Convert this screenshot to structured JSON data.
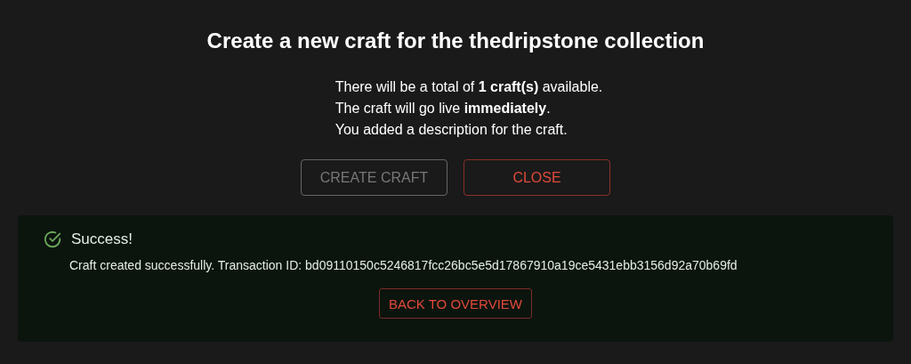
{
  "dialog": {
    "title": "Create a new craft for the thedripstone collection",
    "summary": [
      "There will be a total of **1 craft(s)** available.",
      "The craft will go live **immediately**.",
      "You added a description for the craft."
    ],
    "buttons": [
      {
        "label": "CREATE CRAFT",
        "kind": "primary",
        "disabled": true
      },
      {
        "label": "CLOSE",
        "kind": "danger",
        "disabled": false
      }
    ]
  },
  "alert": {
    "title": "Success!",
    "message": "Craft created successfully. Transaction ID: bd09110150c5246817fcc26bc5e5d17867910a19ce5431ebb3156d92a70b69fd",
    "button": "BACK TO OVERVIEW"
  }
}
